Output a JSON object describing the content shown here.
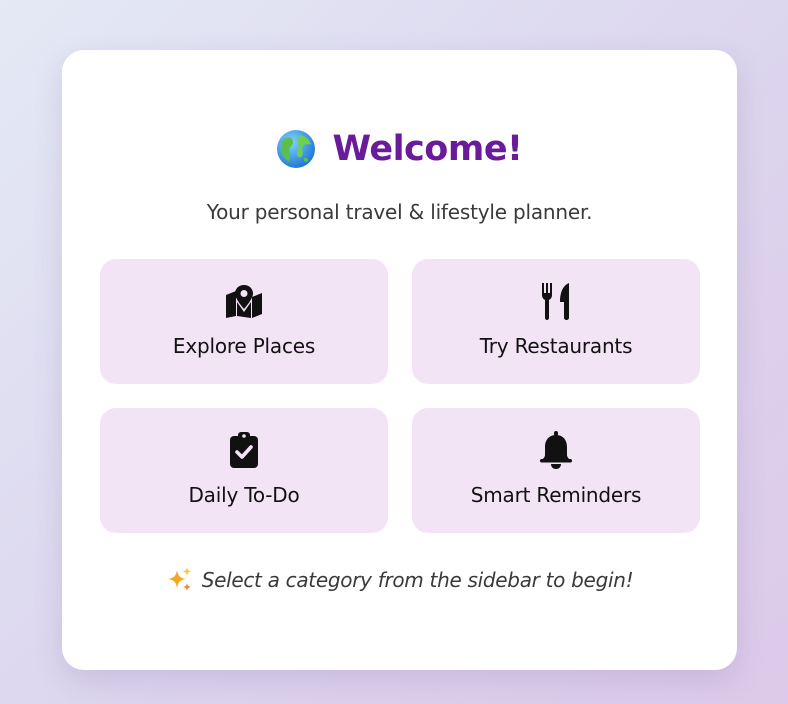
{
  "header": {
    "icon": "globe-icon",
    "title": "Welcome!",
    "title_color": "#6a1b9a"
  },
  "subtitle": "Your personal travel & lifestyle planner.",
  "tiles": [
    {
      "icon": "map-pin-icon",
      "label": "Explore Places"
    },
    {
      "icon": "fork-knife-icon",
      "label": "Try Restaurants"
    },
    {
      "icon": "clipboard-check-icon",
      "label": "Daily To-Do"
    },
    {
      "icon": "bell-icon",
      "label": "Smart Reminders"
    }
  ],
  "footer": {
    "icon": "sparkles-icon",
    "text": "Select a category from the sidebar to begin!"
  },
  "colors": {
    "accent": "#6a1b9a",
    "tile_background": "#f2e4f5",
    "card_background": "#ffffff"
  }
}
